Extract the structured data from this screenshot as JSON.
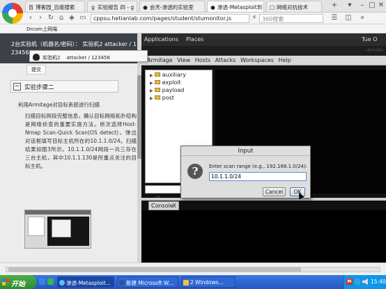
{
  "browser": {
    "tabs": [
      {
        "label": "博客园_百度搜索",
        "icon": "百"
      },
      {
        "label": "实验报告 四 - g",
        "icon": "g"
      },
      {
        "label": "会天-渗透的实验室",
        "icon": "●"
      },
      {
        "label": "渗透-Metasploit到",
        "icon": "●",
        "active": true
      },
      {
        "label": "网络对抗技术",
        "icon": "□"
      }
    ],
    "url": "cppsu.hetianlab.com/pages/student/stumonitor.js",
    "search_placeholder": "360搜索",
    "bookmark": "Drcom上网端"
  },
  "left_panel": {
    "header_line1": "2台实验机（机器名/密码）：  实验机2   attacker / 1",
    "header_line2": "23456",
    "prev_button": "提交",
    "step_icon": "−",
    "step_title": "实验步骤二",
    "step_subtitle": "利用Armitage对目标系统进行扫描",
    "step_body": "扫描目标网段完整信息，确认目标网络拓扑结构是网络侦查的重要实施方法。依次选择Host-Nmap Scan-Quick Scan(OS detect)，弹出对话框填写目标主机所在的10.1.1.0/24。扫描结果如图3所示。10.1.1.0/24网段一共三存在三台主机，其中10.1.1.130是所重点关注的目标主机。"
  },
  "tooltip": {
    "machine": "实验机2",
    "credentials": "attacker / 123456"
  },
  "vm": {
    "top_applications": "Applications",
    "top_places": "Places",
    "top_clock": "Tue O",
    "kali_label": "Armita",
    "menu": [
      "Armitage",
      "View",
      "Hosts",
      "Attacks",
      "Workspaces",
      "Help"
    ],
    "tree": [
      "auxiliary",
      "exploit",
      "payload",
      "post"
    ],
    "console_tab": "Console",
    "console_close": "X"
  },
  "dialog": {
    "title": "Input",
    "prompt": "Enter scan range (e.g., 192.168.1.0/24):",
    "value": "10.1.1.0/24",
    "cancel": "Cancel",
    "ok": "OK"
  },
  "taskbar": {
    "start": "开始",
    "tasks": [
      "渗透-Metasploit...",
      "新建 Microsoft W...",
      "2 Windows..."
    ],
    "clock": "15:40"
  }
}
